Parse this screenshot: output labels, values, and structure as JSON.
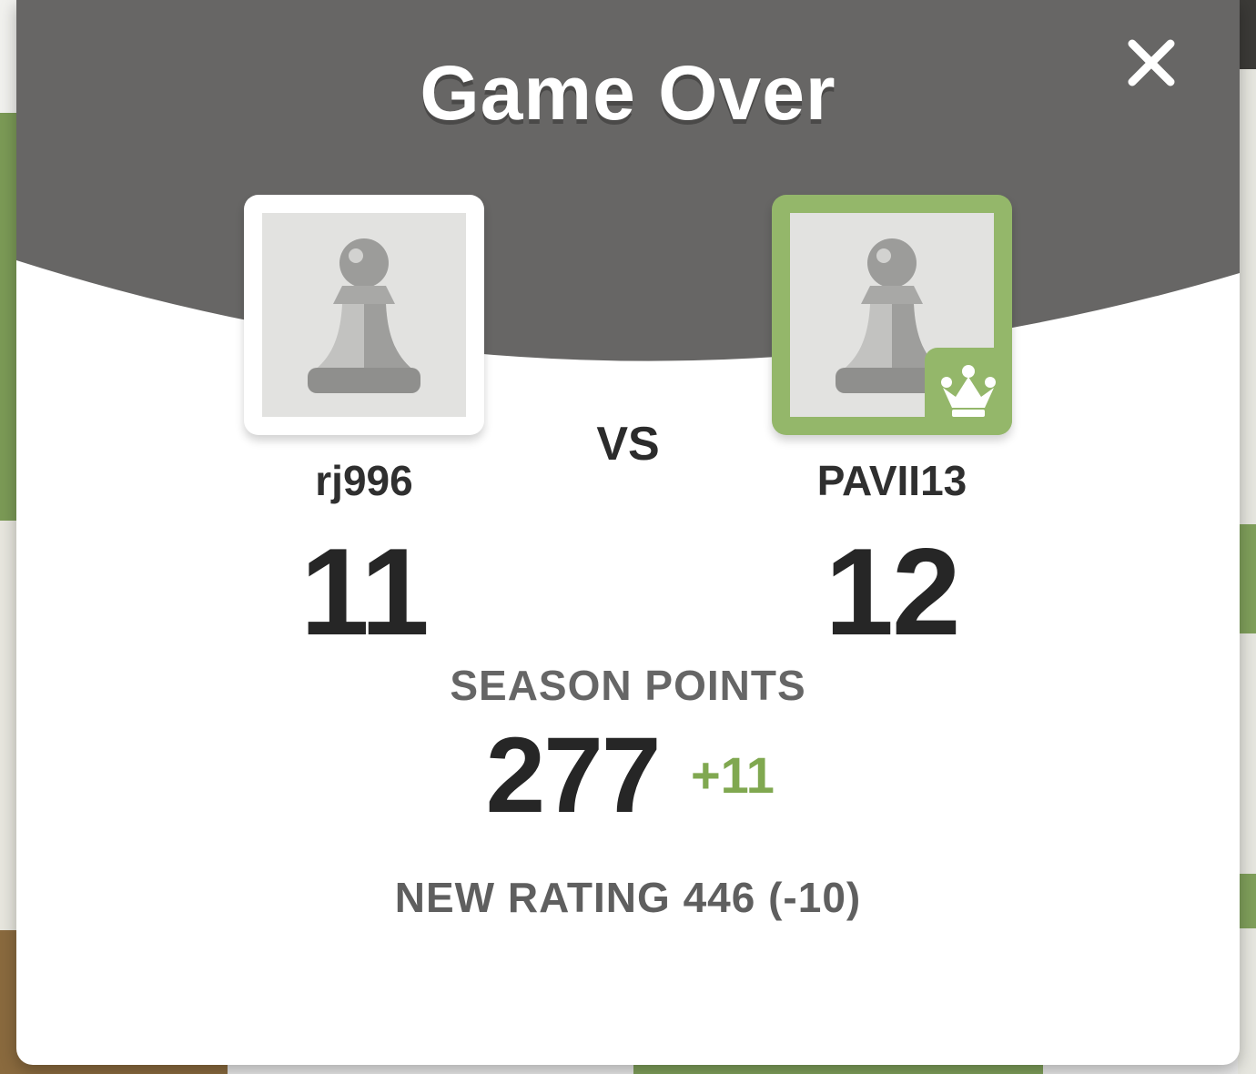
{
  "modal": {
    "title": "Game Over",
    "close_icon": "close-icon"
  },
  "players": {
    "left": {
      "name": "rj996",
      "score": "11",
      "avatar_icon": "pawn-icon",
      "frame_color": "#ffffff"
    },
    "vs_label": "VS",
    "right": {
      "name": "PAVII13",
      "score": "12",
      "avatar_icon": "pawn-icon",
      "badge_icon": "crown-icon",
      "frame_color": "#94b76a"
    }
  },
  "season": {
    "label": "SEASON POINTS",
    "value": "277",
    "delta": "+11",
    "delta_color": "#80a850"
  },
  "rating": {
    "text": "NEW RATING 446 (-10)"
  },
  "colors": {
    "header": "#676665",
    "accent_green": "#94b76a",
    "modal_background": "#ffffff"
  }
}
